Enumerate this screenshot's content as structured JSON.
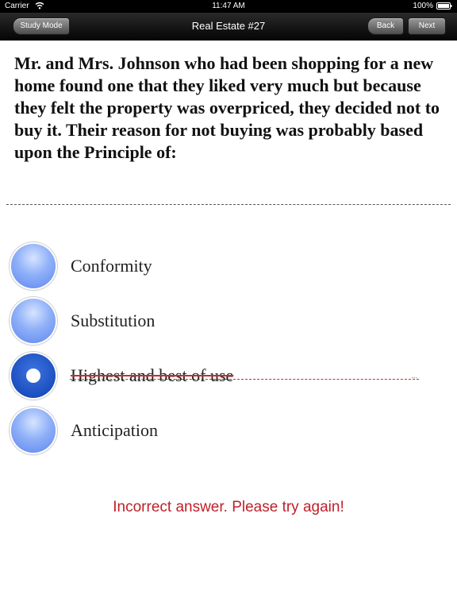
{
  "status_bar": {
    "carrier": "Carrier",
    "time": "11:47 AM",
    "battery": "100%",
    "wifi_icon": "wifi-icon",
    "battery_icon": "battery-icon"
  },
  "nav": {
    "title": "Real Estate #27",
    "study_mode_label": "Study Mode",
    "back_label": "Back",
    "next_label": "Next"
  },
  "question": {
    "text": "Mr. and Mrs. Johnson who had been shopping for a new home found one that they liked very much but because they felt the property was overpriced, they decided not to buy it. Their reason for not buying was probably based upon the Principle of:"
  },
  "options": [
    {
      "label": "Conformity",
      "selected": false,
      "incorrect": false
    },
    {
      "label": "Substitution",
      "selected": false,
      "incorrect": false
    },
    {
      "label": "Highest and best of use",
      "selected": true,
      "incorrect": true
    },
    {
      "label": "Anticipation",
      "selected": false,
      "incorrect": false
    }
  ],
  "option_ellipsis": "...",
  "feedback": "Incorrect answer. Please try again!",
  "colors": {
    "radio_unselected": "#8fb0f8",
    "radio_selected": "#1c4fc0",
    "incorrect": "#c0202a"
  }
}
